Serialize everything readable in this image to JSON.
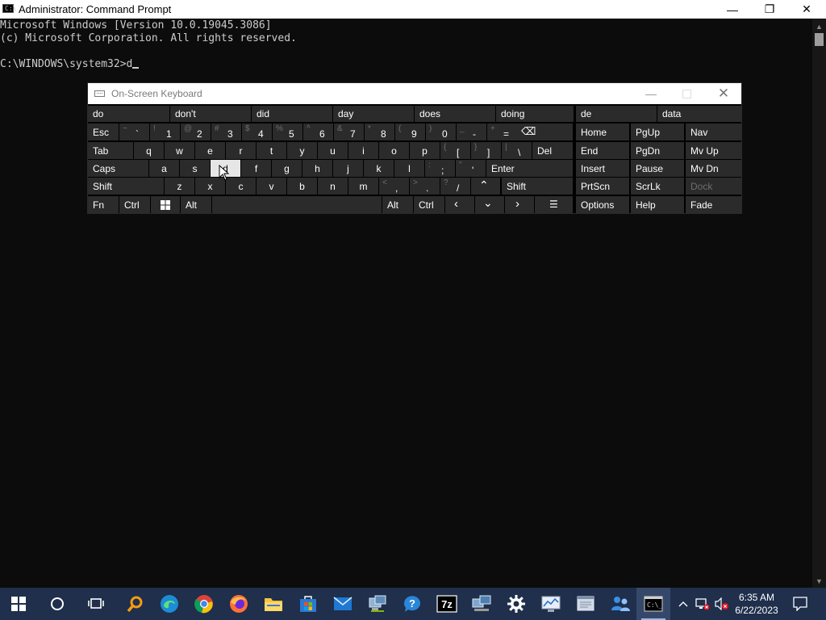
{
  "cmd": {
    "title": "Administrator: Command Prompt",
    "lines": [
      "Microsoft Windows [Version 10.0.19045.3086]",
      "(c) Microsoft Corporation. All rights reserved.",
      "",
      "C:\\WINDOWS\\system32>d"
    ],
    "controls": {
      "minimize": "—",
      "maximize": "❐",
      "close": "✕"
    }
  },
  "osk": {
    "title": "On-Screen Keyboard",
    "predictions": [
      "do",
      "don't",
      "did",
      "day",
      "does",
      "doing",
      "de",
      "data"
    ],
    "row1": [
      {
        "shift": "~",
        "main": "`"
      },
      {
        "shift": "!",
        "main": "1"
      },
      {
        "shift": "@",
        "main": "2"
      },
      {
        "shift": "#",
        "main": "3"
      },
      {
        "shift": "$",
        "main": "4"
      },
      {
        "shift": "%",
        "main": "5"
      },
      {
        "shift": "^",
        "main": "6"
      },
      {
        "shift": "&",
        "main": "7"
      },
      {
        "shift": "*",
        "main": "8"
      },
      {
        "shift": "(",
        "main": "9"
      },
      {
        "shift": ")",
        "main": "0"
      },
      {
        "shift": "_",
        "main": "-"
      },
      {
        "shift": "+",
        "main": "="
      }
    ],
    "row2_letters": [
      "q",
      "w",
      "e",
      "r",
      "t",
      "y",
      "u",
      "i",
      "o",
      "p"
    ],
    "row2_brackets": [
      {
        "shift": "{",
        "main": "["
      },
      {
        "shift": "}",
        "main": "]"
      },
      {
        "shift": "|",
        "main": "\\"
      }
    ],
    "row3_letters": [
      "a",
      "s",
      "d",
      "f",
      "g",
      "h",
      "j",
      "k",
      "l"
    ],
    "row3_punct": [
      {
        "shift": ":",
        "main": ";"
      },
      {
        "shift": "\"",
        "main": "'"
      }
    ],
    "row4_letters": [
      "z",
      "x",
      "c",
      "v",
      "b",
      "n",
      "m"
    ],
    "row4_punct": [
      {
        "shift": "<",
        "main": ","
      },
      {
        "shift": ">",
        "main": "."
      },
      {
        "shift": "?",
        "main": "/"
      }
    ],
    "labels": {
      "esc": "Esc",
      "tab": "Tab",
      "caps": "Caps",
      "shift": "Shift",
      "fn": "Fn",
      "ctrl": "Ctrl",
      "alt": "Alt",
      "del": "Del",
      "enter": "Enter",
      "shift_r": "Shift",
      "alt_r": "Alt",
      "ctrl_r": "Ctrl",
      "home": "Home",
      "pgup": "PgUp",
      "nav": "Nav",
      "end": "End",
      "pgdn": "PgDn",
      "mvup": "Mv Up",
      "insert": "Insert",
      "pause": "Pause",
      "mvdn": "Mv Dn",
      "prtscn": "PrtScn",
      "scrlk": "ScrLk",
      "dock": "Dock",
      "options": "Options",
      "help": "Help",
      "fade": "Fade"
    },
    "hovered_key": "d"
  },
  "taskbar": {
    "apps": [
      "start",
      "search",
      "task-view",
      "search-app",
      "edge",
      "chrome",
      "firefox",
      "file-explorer",
      "store",
      "mail",
      "network-tool",
      "help",
      "7zip",
      "network-tool-2",
      "settings",
      "monitor-tool",
      "notes-tool",
      "people-tool",
      "command-prompt"
    ],
    "active_app": "command-prompt",
    "clock_time": "6:35 AM",
    "clock_date": "6/22/2023"
  }
}
